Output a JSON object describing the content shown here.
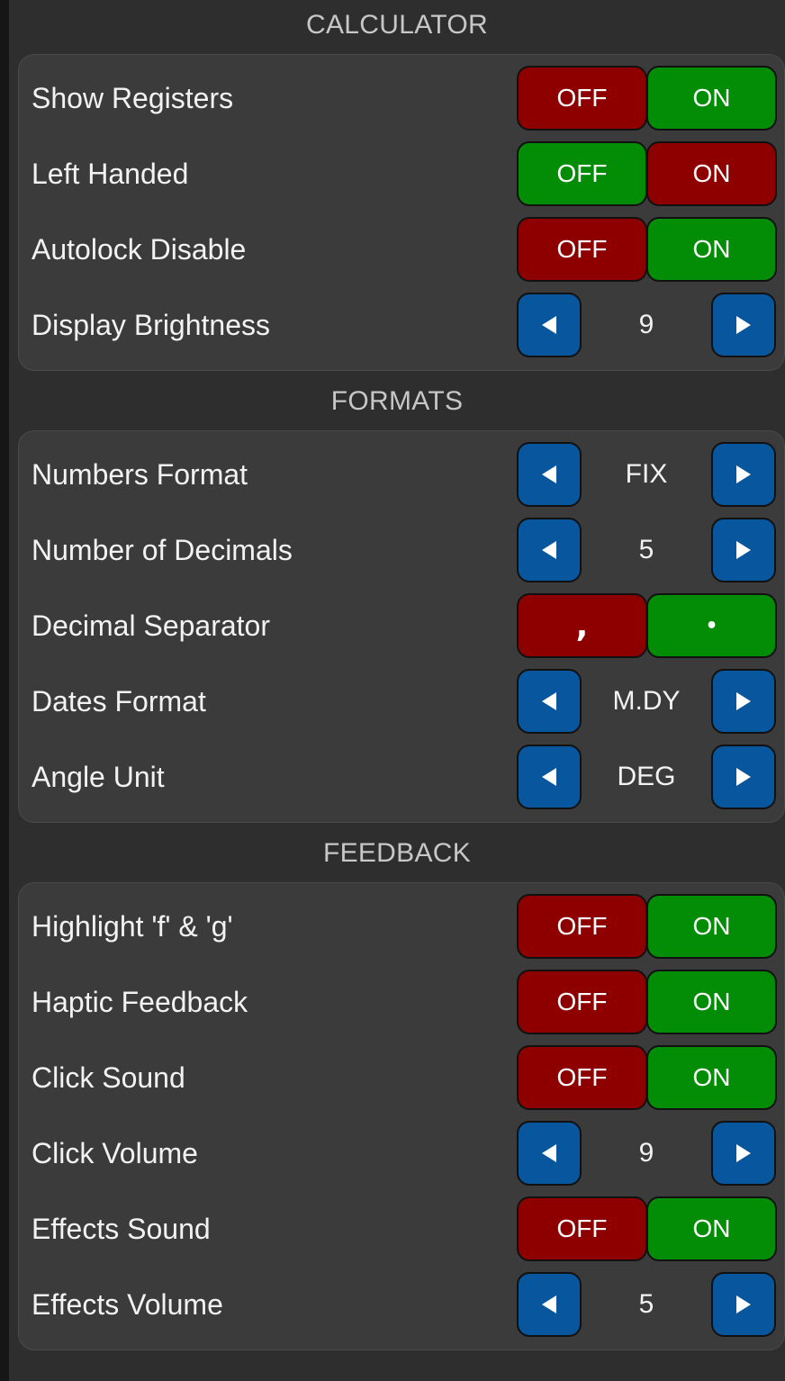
{
  "colors": {
    "off_red": "#8e0000",
    "on_green": "#038c06",
    "stepper_blue": "#07569e",
    "panel": "#3b3b3b",
    "background": "#2e2e2e"
  },
  "calculator": {
    "header": "CALCULATOR",
    "show_registers": {
      "label": "Show Registers",
      "off": "OFF",
      "on": "ON",
      "selected": "on"
    },
    "left_handed": {
      "label": "Left Handed",
      "off": "OFF",
      "on": "ON",
      "selected": "off"
    },
    "autolock_disable": {
      "label": "Autolock Disable",
      "off": "OFF",
      "on": "ON",
      "selected": "on"
    },
    "display_brightness": {
      "label": "Display Brightness",
      "value": "9",
      "decrement_icon": "triangle-left-icon",
      "increment_icon": "triangle-right-icon"
    }
  },
  "formats": {
    "header": "FORMATS",
    "numbers_format": {
      "label": "Numbers Format",
      "value": "FIX"
    },
    "number_of_decimals": {
      "label": "Number of Decimals",
      "value": "5"
    },
    "decimal_separator": {
      "label": "Decimal Separator",
      "comma": ",",
      "point": "•",
      "selected": "point"
    },
    "dates_format": {
      "label": "Dates Format",
      "value": "M.DY"
    },
    "angle_unit": {
      "label": "Angle Unit",
      "value": "DEG"
    }
  },
  "feedback": {
    "header": "FEEDBACK",
    "highlight_fg": {
      "label": "Highlight 'f' & 'g'",
      "off": "OFF",
      "on": "ON",
      "selected": "on"
    },
    "haptic_feedback": {
      "label": "Haptic Feedback",
      "off": "OFF",
      "on": "ON",
      "selected": "on"
    },
    "click_sound": {
      "label": "Click Sound",
      "off": "OFF",
      "on": "ON",
      "selected": "on"
    },
    "click_volume": {
      "label": "Click Volume",
      "value": "9"
    },
    "effects_sound": {
      "label": "Effects Sound",
      "off": "OFF",
      "on": "ON",
      "selected": "on"
    },
    "effects_volume": {
      "label": "Effects Volume",
      "value": "5"
    }
  }
}
